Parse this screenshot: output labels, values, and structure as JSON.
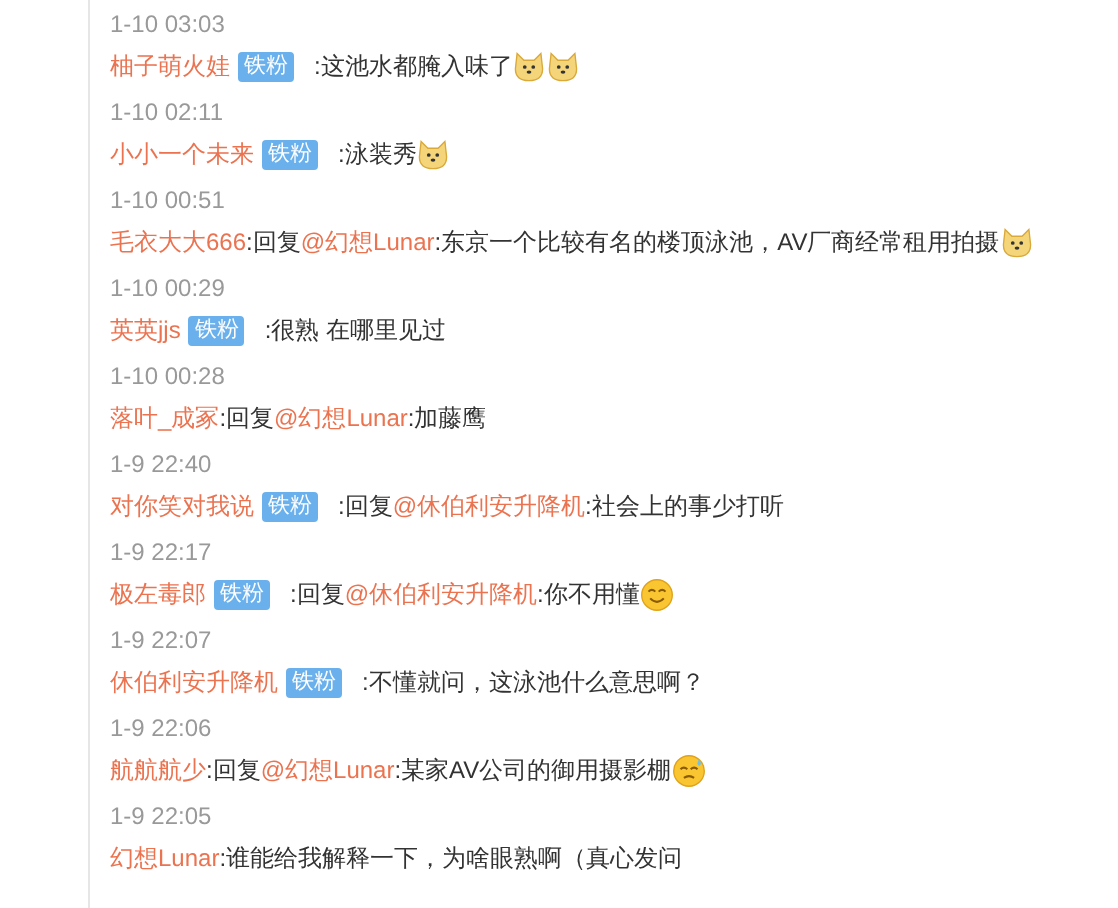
{
  "comments": [
    {
      "time": "1-10 03:03",
      "user": "柚子萌火娃",
      "badge": "铁粉",
      "text": ":这池水都腌入味了",
      "emojis": [
        {
          "kind": "doge"
        },
        {
          "kind": "doge"
        }
      ]
    },
    {
      "time": "1-10 02:11",
      "user": "小小一个未来",
      "badge": "铁粉",
      "text": ":泳装秀",
      "emojis": [
        {
          "kind": "doge"
        }
      ]
    },
    {
      "time": "1-10 00:51",
      "user": "毛衣大大666",
      "reply_prefix": ":回复",
      "reply_to": "@幻想Lunar",
      "text": ":东京一个比较有名的楼顶泳池，AV厂商经常租用拍摄",
      "emojis": [
        {
          "kind": "doge"
        }
      ]
    },
    {
      "time": "1-10 00:29",
      "user": "英英jjs",
      "badge": "铁粉",
      "text": ":很熟 在哪里见过"
    },
    {
      "time": "1-10 00:28",
      "user": "落叶_成冢",
      "reply_prefix": ":回复",
      "reply_to": "@幻想Lunar",
      "text": ":加藤鹰"
    },
    {
      "time": "1-9 22:40",
      "user": "对你笑对我说",
      "badge": "铁粉",
      "reply_prefix": ":回复",
      "reply_to": "@休伯利安升降机",
      "text": ":社会上的事少打听"
    },
    {
      "time": "1-9 22:17",
      "user": "极左毒郎",
      "badge": "铁粉",
      "reply_prefix": ":回复",
      "reply_to": "@休伯利安升降机",
      "text": ":你不用懂",
      "emojis": [
        {
          "kind": "smile"
        }
      ]
    },
    {
      "time": "1-9 22:07",
      "user": "休伯利安升降机",
      "badge": "铁粉",
      "text": ":不懂就问，这泳池什么意思啊？"
    },
    {
      "time": "1-9 22:06",
      "user": "航航航少",
      "reply_prefix": ":回复",
      "reply_to": "@幻想Lunar",
      "text": ":某家AV公司的御用摄影棚",
      "emojis": [
        {
          "kind": "sweat"
        }
      ]
    },
    {
      "time": "1-9 22:05",
      "user": "幻想Lunar",
      "text": ":谁能给我解释一下，为啥眼熟啊（真心发问"
    }
  ]
}
